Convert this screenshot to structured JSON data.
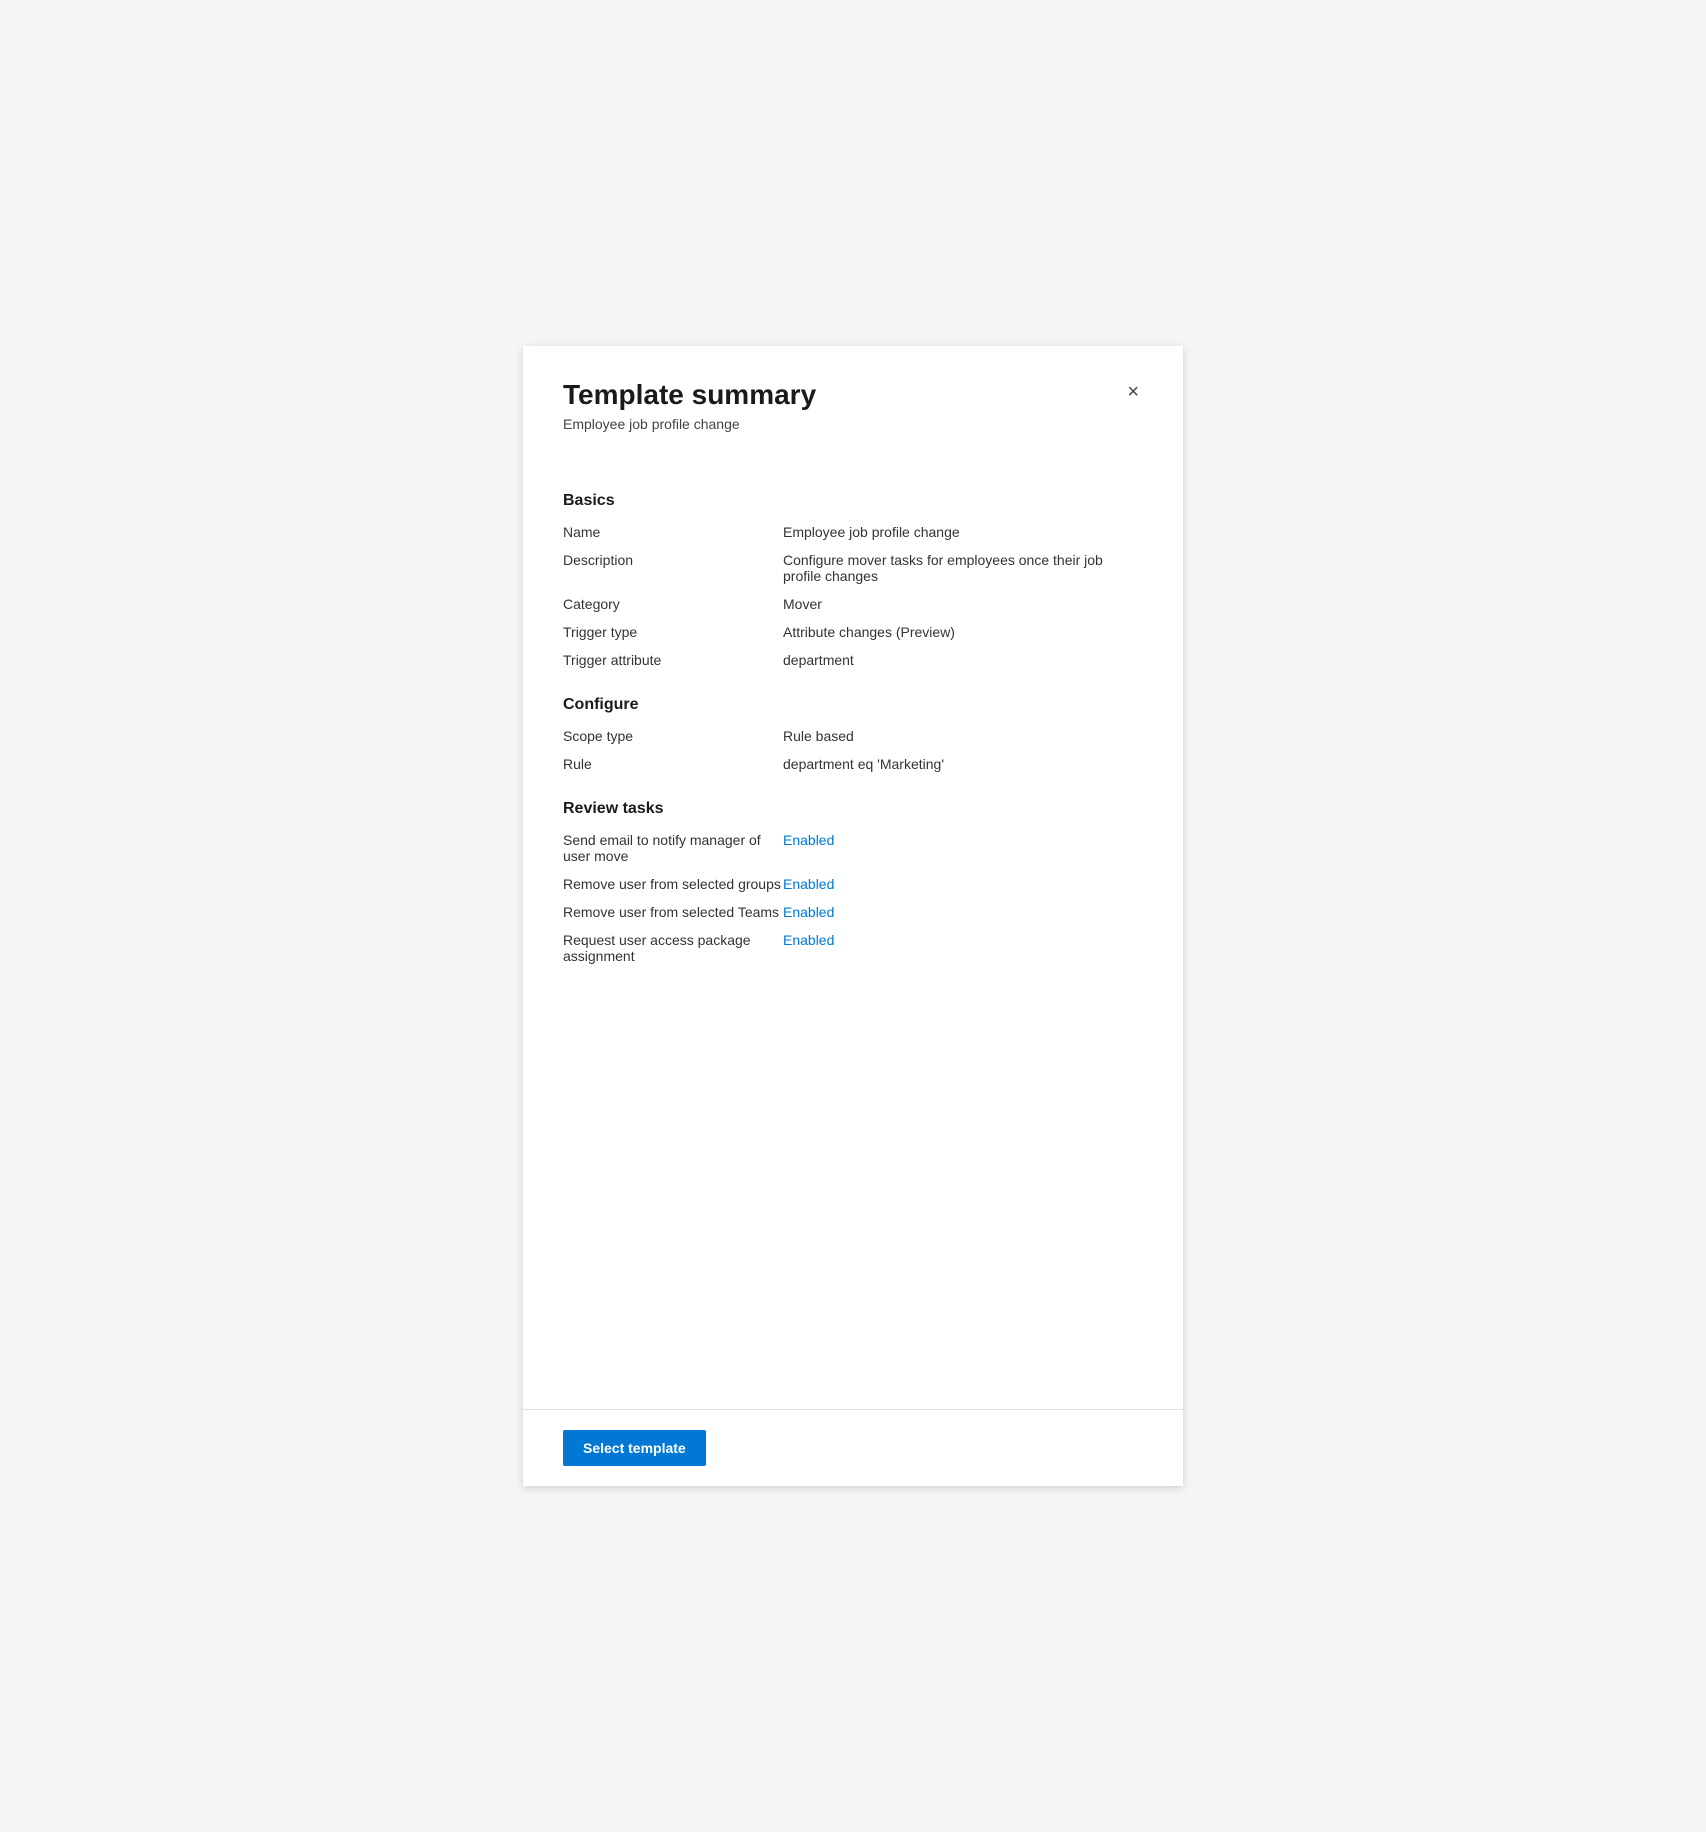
{
  "panel": {
    "title": "Template summary",
    "subtitle": "Employee job profile change",
    "close_icon": "×"
  },
  "sections": {
    "basics": {
      "heading": "Basics",
      "fields": [
        {
          "label": "Name",
          "value": "Employee job profile change",
          "enabled": false
        },
        {
          "label": "Description",
          "value": "Configure mover tasks for employees once their job profile changes",
          "enabled": false
        },
        {
          "label": "Category",
          "value": "Mover",
          "enabled": false
        },
        {
          "label": "Trigger type",
          "value": "Attribute changes (Preview)",
          "enabled": false
        },
        {
          "label": "Trigger attribute",
          "value": "department",
          "enabled": false
        }
      ]
    },
    "configure": {
      "heading": "Configure",
      "fields": [
        {
          "label": "Scope type",
          "value": "Rule based",
          "enabled": false
        },
        {
          "label": "Rule",
          "value": "department eq 'Marketing'",
          "enabled": false
        }
      ]
    },
    "review_tasks": {
      "heading": "Review tasks",
      "fields": [
        {
          "label": "Send email to notify manager of user move",
          "value": "Enabled",
          "enabled": true
        },
        {
          "label": "Remove user from selected groups",
          "value": "Enabled",
          "enabled": true
        },
        {
          "label": "Remove user from selected Teams",
          "value": "Enabled",
          "enabled": true
        },
        {
          "label": "Request user access package assignment",
          "value": "Enabled",
          "enabled": true
        }
      ]
    }
  },
  "footer": {
    "button_label": "Select template"
  }
}
